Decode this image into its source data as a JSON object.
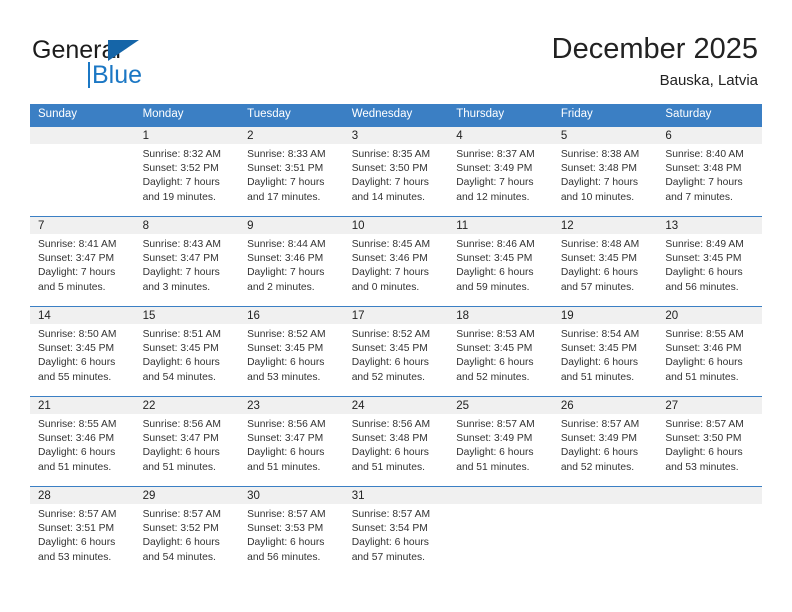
{
  "brand": {
    "name_part1": "General",
    "name_part2": "Blue",
    "logo_icon": "triangle-logo-icon"
  },
  "header": {
    "month_title": "December 2025",
    "location": "Bauska, Latvia"
  },
  "colors": {
    "header_blue": "#3b7fc4",
    "brand_blue": "#1b77c4",
    "daynum_band": "#f0f0f0",
    "text": "#222222"
  },
  "weekday_headers": [
    "Sunday",
    "Monday",
    "Tuesday",
    "Wednesday",
    "Thursday",
    "Friday",
    "Saturday"
  ],
  "weeks": [
    [
      {
        "day": "",
        "empty": true,
        "sunrise": "",
        "sunset": "",
        "daylight1": "",
        "daylight2": ""
      },
      {
        "day": "1",
        "empty": false,
        "sunrise": "Sunrise: 8:32 AM",
        "sunset": "Sunset: 3:52 PM",
        "daylight1": "Daylight: 7 hours",
        "daylight2": "and 19 minutes."
      },
      {
        "day": "2",
        "empty": false,
        "sunrise": "Sunrise: 8:33 AM",
        "sunset": "Sunset: 3:51 PM",
        "daylight1": "Daylight: 7 hours",
        "daylight2": "and 17 minutes."
      },
      {
        "day": "3",
        "empty": false,
        "sunrise": "Sunrise: 8:35 AM",
        "sunset": "Sunset: 3:50 PM",
        "daylight1": "Daylight: 7 hours",
        "daylight2": "and 14 minutes."
      },
      {
        "day": "4",
        "empty": false,
        "sunrise": "Sunrise: 8:37 AM",
        "sunset": "Sunset: 3:49 PM",
        "daylight1": "Daylight: 7 hours",
        "daylight2": "and 12 minutes."
      },
      {
        "day": "5",
        "empty": false,
        "sunrise": "Sunrise: 8:38 AM",
        "sunset": "Sunset: 3:48 PM",
        "daylight1": "Daylight: 7 hours",
        "daylight2": "and 10 minutes."
      },
      {
        "day": "6",
        "empty": false,
        "sunrise": "Sunrise: 8:40 AM",
        "sunset": "Sunset: 3:48 PM",
        "daylight1": "Daylight: 7 hours",
        "daylight2": "and 7 minutes."
      }
    ],
    [
      {
        "day": "7",
        "empty": false,
        "sunrise": "Sunrise: 8:41 AM",
        "sunset": "Sunset: 3:47 PM",
        "daylight1": "Daylight: 7 hours",
        "daylight2": "and 5 minutes."
      },
      {
        "day": "8",
        "empty": false,
        "sunrise": "Sunrise: 8:43 AM",
        "sunset": "Sunset: 3:47 PM",
        "daylight1": "Daylight: 7 hours",
        "daylight2": "and 3 minutes."
      },
      {
        "day": "9",
        "empty": false,
        "sunrise": "Sunrise: 8:44 AM",
        "sunset": "Sunset: 3:46 PM",
        "daylight1": "Daylight: 7 hours",
        "daylight2": "and 2 minutes."
      },
      {
        "day": "10",
        "empty": false,
        "sunrise": "Sunrise: 8:45 AM",
        "sunset": "Sunset: 3:46 PM",
        "daylight1": "Daylight: 7 hours",
        "daylight2": "and 0 minutes."
      },
      {
        "day": "11",
        "empty": false,
        "sunrise": "Sunrise: 8:46 AM",
        "sunset": "Sunset: 3:45 PM",
        "daylight1": "Daylight: 6 hours",
        "daylight2": "and 59 minutes."
      },
      {
        "day": "12",
        "empty": false,
        "sunrise": "Sunrise: 8:48 AM",
        "sunset": "Sunset: 3:45 PM",
        "daylight1": "Daylight: 6 hours",
        "daylight2": "and 57 minutes."
      },
      {
        "day": "13",
        "empty": false,
        "sunrise": "Sunrise: 8:49 AM",
        "sunset": "Sunset: 3:45 PM",
        "daylight1": "Daylight: 6 hours",
        "daylight2": "and 56 minutes."
      }
    ],
    [
      {
        "day": "14",
        "empty": false,
        "sunrise": "Sunrise: 8:50 AM",
        "sunset": "Sunset: 3:45 PM",
        "daylight1": "Daylight: 6 hours",
        "daylight2": "and 55 minutes."
      },
      {
        "day": "15",
        "empty": false,
        "sunrise": "Sunrise: 8:51 AM",
        "sunset": "Sunset: 3:45 PM",
        "daylight1": "Daylight: 6 hours",
        "daylight2": "and 54 minutes."
      },
      {
        "day": "16",
        "empty": false,
        "sunrise": "Sunrise: 8:52 AM",
        "sunset": "Sunset: 3:45 PM",
        "daylight1": "Daylight: 6 hours",
        "daylight2": "and 53 minutes."
      },
      {
        "day": "17",
        "empty": false,
        "sunrise": "Sunrise: 8:52 AM",
        "sunset": "Sunset: 3:45 PM",
        "daylight1": "Daylight: 6 hours",
        "daylight2": "and 52 minutes."
      },
      {
        "day": "18",
        "empty": false,
        "sunrise": "Sunrise: 8:53 AM",
        "sunset": "Sunset: 3:45 PM",
        "daylight1": "Daylight: 6 hours",
        "daylight2": "and 52 minutes."
      },
      {
        "day": "19",
        "empty": false,
        "sunrise": "Sunrise: 8:54 AM",
        "sunset": "Sunset: 3:45 PM",
        "daylight1": "Daylight: 6 hours",
        "daylight2": "and 51 minutes."
      },
      {
        "day": "20",
        "empty": false,
        "sunrise": "Sunrise: 8:55 AM",
        "sunset": "Sunset: 3:46 PM",
        "daylight1": "Daylight: 6 hours",
        "daylight2": "and 51 minutes."
      }
    ],
    [
      {
        "day": "21",
        "empty": false,
        "sunrise": "Sunrise: 8:55 AM",
        "sunset": "Sunset: 3:46 PM",
        "daylight1": "Daylight: 6 hours",
        "daylight2": "and 51 minutes."
      },
      {
        "day": "22",
        "empty": false,
        "sunrise": "Sunrise: 8:56 AM",
        "sunset": "Sunset: 3:47 PM",
        "daylight1": "Daylight: 6 hours",
        "daylight2": "and 51 minutes."
      },
      {
        "day": "23",
        "empty": false,
        "sunrise": "Sunrise: 8:56 AM",
        "sunset": "Sunset: 3:47 PM",
        "daylight1": "Daylight: 6 hours",
        "daylight2": "and 51 minutes."
      },
      {
        "day": "24",
        "empty": false,
        "sunrise": "Sunrise: 8:56 AM",
        "sunset": "Sunset: 3:48 PM",
        "daylight1": "Daylight: 6 hours",
        "daylight2": "and 51 minutes."
      },
      {
        "day": "25",
        "empty": false,
        "sunrise": "Sunrise: 8:57 AM",
        "sunset": "Sunset: 3:49 PM",
        "daylight1": "Daylight: 6 hours",
        "daylight2": "and 51 minutes."
      },
      {
        "day": "26",
        "empty": false,
        "sunrise": "Sunrise: 8:57 AM",
        "sunset": "Sunset: 3:49 PM",
        "daylight1": "Daylight: 6 hours",
        "daylight2": "and 52 minutes."
      },
      {
        "day": "27",
        "empty": false,
        "sunrise": "Sunrise: 8:57 AM",
        "sunset": "Sunset: 3:50 PM",
        "daylight1": "Daylight: 6 hours",
        "daylight2": "and 53 minutes."
      }
    ],
    [
      {
        "day": "28",
        "empty": false,
        "sunrise": "Sunrise: 8:57 AM",
        "sunset": "Sunset: 3:51 PM",
        "daylight1": "Daylight: 6 hours",
        "daylight2": "and 53 minutes."
      },
      {
        "day": "29",
        "empty": false,
        "sunrise": "Sunrise: 8:57 AM",
        "sunset": "Sunset: 3:52 PM",
        "daylight1": "Daylight: 6 hours",
        "daylight2": "and 54 minutes."
      },
      {
        "day": "30",
        "empty": false,
        "sunrise": "Sunrise: 8:57 AM",
        "sunset": "Sunset: 3:53 PM",
        "daylight1": "Daylight: 6 hours",
        "daylight2": "and 56 minutes."
      },
      {
        "day": "31",
        "empty": false,
        "sunrise": "Sunrise: 8:57 AM",
        "sunset": "Sunset: 3:54 PM",
        "daylight1": "Daylight: 6 hours",
        "daylight2": "and 57 minutes."
      },
      {
        "day": "",
        "empty": true,
        "sunrise": "",
        "sunset": "",
        "daylight1": "",
        "daylight2": ""
      },
      {
        "day": "",
        "empty": true,
        "sunrise": "",
        "sunset": "",
        "daylight1": "",
        "daylight2": ""
      },
      {
        "day": "",
        "empty": true,
        "sunrise": "",
        "sunset": "",
        "daylight1": "",
        "daylight2": ""
      }
    ]
  ]
}
